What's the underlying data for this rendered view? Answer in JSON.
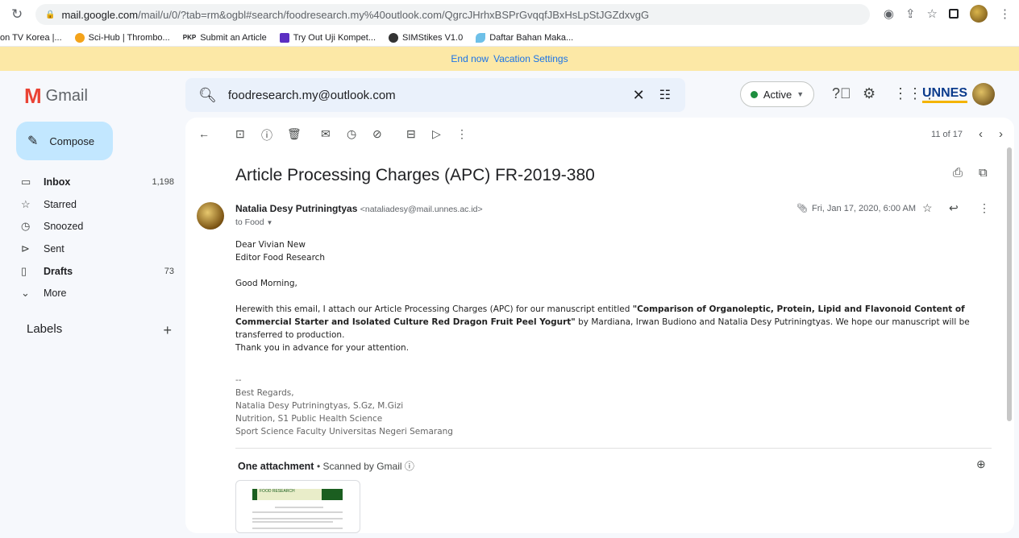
{
  "browser": {
    "url_host": "mail.google.com",
    "url_rest": "/mail/u/0/?tab=rm&ogbl#search/foodresearch.my%40outlook.com/QgrcJHrhxBSPrGvqqfJBxHsLpStJGZdxvgG",
    "bookmarks": [
      {
        "label": "on TV Korea |...",
        "color": "#ffffff"
      },
      {
        "label": "Sci-Hub | Thrombo...",
        "color": "#f4a31a"
      },
      {
        "label": "Submit an Article",
        "color": "#000000",
        "prefix": "PKP"
      },
      {
        "label": "Try Out Uji Kompet...",
        "color": "#5c2fc2"
      },
      {
        "label": "SIMStikes V1.0",
        "color": "#333333"
      },
      {
        "label": "Daftar Bahan Maka...",
        "color": "#6ec0e8"
      }
    ]
  },
  "vacation": {
    "end_label": "End now",
    "settings_label": "Vacation Settings"
  },
  "header": {
    "app_name": "Gmail",
    "search_value": "foodresearch.my@outlook.com",
    "status": "Active",
    "org_logo": "UNNES"
  },
  "sidebar": {
    "compose": "Compose",
    "items": [
      {
        "label": "Inbox",
        "count": "1,198",
        "icon": "inbox-icon",
        "bold": true
      },
      {
        "label": "Starred",
        "count": "",
        "icon": "star-icon",
        "bold": false
      },
      {
        "label": "Snoozed",
        "count": "",
        "icon": "clock-icon",
        "bold": false
      },
      {
        "label": "Sent",
        "count": "",
        "icon": "send-icon",
        "bold": false
      },
      {
        "label": "Drafts",
        "count": "73",
        "icon": "draft-icon",
        "bold": true
      },
      {
        "label": "More",
        "count": "",
        "icon": "chevron-down-icon",
        "bold": false
      }
    ],
    "labels_heading": "Labels"
  },
  "toolbar": {
    "pager": "11 of 17"
  },
  "email": {
    "subject": "Article Processing Charges (APC) FR-2019-380",
    "sender_name": "Natalia Desy Putriningtyas",
    "sender_email": "<nataliadesy@mail.unnes.ac.id>",
    "to": "to Food",
    "date": "Fri, Jan 17, 2020, 6:00 AM",
    "greeting_1": "Dear Vivian New",
    "greeting_2": "Editor Food Research",
    "salutation": "Good Morning,",
    "para_lead": "Herewith this email, I attach our Article Processing Charges (APC) for our manuscript entitled ",
    "para_title": "\"Comparison of Organoleptic, Protein, Lipid and Flavonoid Content of Commercial Starter and Isolated Culture Red Dragon Fruit Peel Yogurt\"",
    "para_tail": " by Mardiana, Irwan Budiono and Natalia Desy Putriningtyas. We hope our manuscript will be transferred to production.",
    "thanks": "Thank you in advance for your attention.",
    "sig_dash": "--",
    "sig_1": "Best Regards,",
    "sig_2": "Natalia Desy Putriningtyas, S.Gz, M.Gizi",
    "sig_3": "Nutrition, S1 Public Health Science",
    "sig_4": "Sport Science Faculty Universitas Negeri Semarang"
  },
  "attachment": {
    "heading": "One attachment",
    "scanned": "Scanned by Gmail",
    "thumb_title": "FOOD RESEARCH"
  }
}
